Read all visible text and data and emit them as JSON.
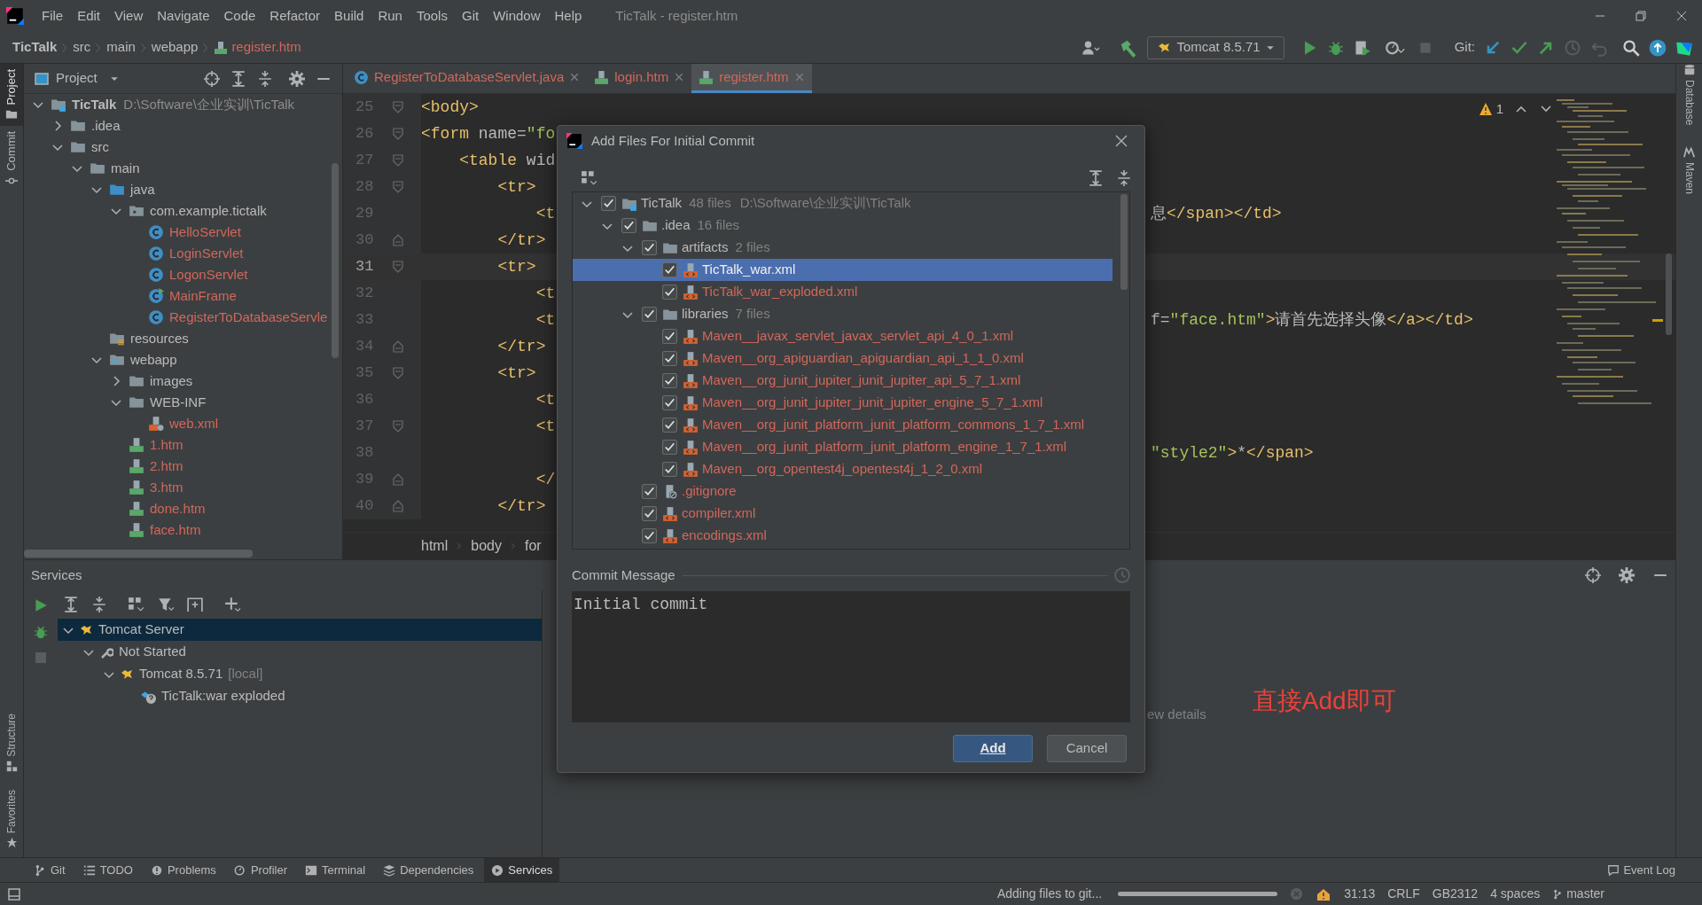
{
  "menu": {
    "items": [
      "File",
      "Edit",
      "View",
      "Navigate",
      "Code",
      "Refactor",
      "Build",
      "Run",
      "Tools",
      "Git",
      "Window",
      "Help"
    ],
    "title": "TicTalk - register.htm"
  },
  "breadcrumbs": [
    {
      "label": "TicTalk",
      "kind": "project"
    },
    {
      "label": "src",
      "kind": "folder"
    },
    {
      "label": "main",
      "kind": "folder"
    },
    {
      "label": "webapp",
      "kind": "folder"
    },
    {
      "label": "register.htm",
      "kind": "file"
    }
  ],
  "run_config": "Tomcat 8.5.71",
  "git_label": "Git:",
  "left_tool_tabs": [
    {
      "label": "Project",
      "selected": true
    },
    {
      "label": "Commit",
      "selected": false
    }
  ],
  "left_tool_tabs_bottom": [
    {
      "label": "Structure"
    },
    {
      "label": "Favorites"
    }
  ],
  "right_tool_tabs": [
    {
      "label": "Database"
    },
    {
      "label": "Maven"
    }
  ],
  "project": {
    "title": "Project",
    "tree": [
      {
        "label": "TicTalk",
        "hint": "D:\\Software\\企业实训\\TicTalk",
        "kind": "module",
        "expanded": true,
        "unversioned": false,
        "children": [
          {
            "label": ".idea",
            "kind": "folder",
            "expanded": false,
            "unversioned": false
          },
          {
            "label": "src",
            "kind": "folder",
            "expanded": true,
            "unversioned": false,
            "children": [
              {
                "label": "main",
                "kind": "folder",
                "expanded": true,
                "unversioned": false,
                "children": [
                  {
                    "label": "java",
                    "kind": "source",
                    "expanded": true,
                    "unversioned": false,
                    "children": [
                      {
                        "label": "com.example.tictalk",
                        "kind": "package",
                        "expanded": true,
                        "unversioned": false,
                        "children": [
                          {
                            "label": "HelloServlet",
                            "kind": "class",
                            "unversioned": true
                          },
                          {
                            "label": "LoginServlet",
                            "kind": "class",
                            "unversioned": true
                          },
                          {
                            "label": "LogonServlet",
                            "kind": "class",
                            "unversioned": true
                          },
                          {
                            "label": "MainFrame",
                            "kind": "main-class",
                            "unversioned": true
                          },
                          {
                            "label": "RegisterToDatabaseServle",
                            "kind": "class",
                            "unversioned": true
                          }
                        ]
                      }
                    ]
                  },
                  {
                    "label": "resources",
                    "kind": "resources",
                    "unversioned": false
                  },
                  {
                    "label": "webapp",
                    "kind": "webapp",
                    "expanded": true,
                    "unversioned": false,
                    "children": [
                      {
                        "label": "images",
                        "kind": "folder",
                        "expanded": false,
                        "unversioned": false
                      },
                      {
                        "label": "WEB-INF",
                        "kind": "folder",
                        "expanded": true,
                        "unversioned": false,
                        "children": [
                          {
                            "label": "web.xml",
                            "kind": "webxml",
                            "unversioned": true
                          }
                        ]
                      },
                      {
                        "label": "1.htm",
                        "kind": "html",
                        "unversioned": true
                      },
                      {
                        "label": "2.htm",
                        "kind": "html",
                        "unversioned": true
                      },
                      {
                        "label": "3.htm",
                        "kind": "html",
                        "unversioned": true
                      },
                      {
                        "label": "done.htm",
                        "kind": "html",
                        "unversioned": true
                      },
                      {
                        "label": "face.htm",
                        "kind": "html",
                        "unversioned": true
                      }
                    ]
                  }
                ]
              }
            ]
          }
        ]
      }
    ]
  },
  "editor": {
    "tabs": [
      {
        "label": "RegisterToDatabaseServlet.java",
        "kind": "class",
        "selected": false
      },
      {
        "label": "login.htm",
        "kind": "html",
        "selected": false
      },
      {
        "label": "register.htm",
        "kind": "html",
        "selected": true
      }
    ],
    "warnings": "1",
    "lines": [
      {
        "number": "25",
        "code": "<body>",
        "kind": "fold_start",
        "current": false
      },
      {
        "number": "26",
        "code": "<form name=\"fo",
        "kind": "fold_start",
        "current": false
      },
      {
        "number": "27",
        "code": "    <table wid",
        "kind": "fold_start",
        "current": false
      },
      {
        "number": "28",
        "code": "        <tr>",
        "kind": "fold_start",
        "current": false
      },
      {
        "number": "29",
        "code": "            <t",
        "right": "息</span></td>",
        "kind": "plain",
        "current": false
      },
      {
        "number": "30",
        "code": "        </tr>",
        "kind": "fold_end",
        "current": false
      },
      {
        "number": "31",
        "code": "        <tr>",
        "kind": "fold_start",
        "current": true
      },
      {
        "number": "32",
        "code": "            <t",
        "kind": "plain",
        "current": false
      },
      {
        "number": "33",
        "code": "            <t",
        "right": "f=\"face.htm\">请首先选择头像</a></td>",
        "kind": "plain",
        "current": false
      },
      {
        "number": "34",
        "code": "        </tr>",
        "kind": "fold_end",
        "current": false
      },
      {
        "number": "35",
        "code": "        <tr>",
        "kind": "fold_start",
        "current": false
      },
      {
        "number": "36",
        "code": "            <t",
        "kind": "plain",
        "current": false
      },
      {
        "number": "37",
        "code": "            <t",
        "kind": "fold_start",
        "current": false
      },
      {
        "number": "38",
        "right": "\"style2\">*</span>",
        "kind": "plain",
        "current": false
      },
      {
        "number": "39",
        "code": "            </",
        "kind": "fold_end",
        "current": false
      },
      {
        "number": "40",
        "code": "        </tr>",
        "kind": "fold_end",
        "current": false
      }
    ],
    "breadcrumbs": [
      "html",
      "body",
      "for"
    ]
  },
  "dialog": {
    "title": "Add Files For Initial Commit",
    "tree": [
      {
        "label": "TicTalk",
        "count": "48 files",
        "path": "D:\\Software\\企业实训\\TicTalk",
        "kind": "module",
        "checked": true,
        "expanded": true,
        "selected": false,
        "unversioned": false,
        "children": [
          {
            "label": ".idea",
            "count": "16 files",
            "kind": "folder",
            "checked": true,
            "expanded": true,
            "selected": false,
            "unversioned": false,
            "children": [
              {
                "label": "artifacts",
                "count": "2 files",
                "kind": "folder",
                "checked": true,
                "expanded": true,
                "selected": false,
                "unversioned": false,
                "children": [
                  {
                    "label": "TicTalk_war.xml",
                    "kind": "xml",
                    "checked": true,
                    "selected": true,
                    "unversioned": true
                  },
                  {
                    "label": "TicTalk_war_exploded.xml",
                    "kind": "xml",
                    "checked": true,
                    "selected": false,
                    "unversioned": true
                  }
                ]
              },
              {
                "label": "libraries",
                "count": "7 files",
                "kind": "folder",
                "checked": true,
                "expanded": true,
                "selected": false,
                "unversioned": false,
                "children": [
                  {
                    "label": "Maven__javax_servlet_javax_servlet_api_4_0_1.xml",
                    "kind": "xml",
                    "checked": true,
                    "selected": false,
                    "unversioned": true
                  },
                  {
                    "label": "Maven__org_apiguardian_apiguardian_api_1_1_0.xml",
                    "kind": "xml",
                    "checked": true,
                    "selected": false,
                    "unversioned": true
                  },
                  {
                    "label": "Maven__org_junit_jupiter_junit_jupiter_api_5_7_1.xml",
                    "kind": "xml",
                    "checked": true,
                    "selected": false,
                    "unversioned": true
                  },
                  {
                    "label": "Maven__org_junit_jupiter_junit_jupiter_engine_5_7_1.xml",
                    "kind": "xml",
                    "checked": true,
                    "selected": false,
                    "unversioned": true
                  },
                  {
                    "label": "Maven__org_junit_platform_junit_platform_commons_1_7_1.xml",
                    "kind": "xml",
                    "checked": true,
                    "selected": false,
                    "unversioned": true
                  },
                  {
                    "label": "Maven__org_junit_platform_junit_platform_engine_1_7_1.xml",
                    "kind": "xml",
                    "checked": true,
                    "selected": false,
                    "unversioned": true
                  },
                  {
                    "label": "Maven__org_opentest4j_opentest4j_1_2_0.xml",
                    "kind": "xml",
                    "checked": true,
                    "selected": false,
                    "unversioned": true
                  }
                ]
              },
              {
                "label": ".gitignore",
                "kind": "ignore",
                "checked": true,
                "selected": false,
                "unversioned": true
              },
              {
                "label": "compiler.xml",
                "kind": "xml",
                "checked": true,
                "selected": false,
                "unversioned": true
              },
              {
                "label": "encodings.xml",
                "kind": "xml",
                "checked": true,
                "selected": false,
                "unversioned": true
              }
            ]
          }
        ]
      }
    ],
    "message_label": "Commit Message",
    "message": "Initial commit",
    "buttons": [
      {
        "label": "Add",
        "default": true
      },
      {
        "label": "Cancel",
        "default": false
      }
    ]
  },
  "services": {
    "title": "Services",
    "tree": [
      {
        "label": "Tomcat Server",
        "kind": "tomcat",
        "expanded": true,
        "selected": true,
        "children": [
          {
            "label": "Not Started",
            "kind": "wrench",
            "expanded": true,
            "selected": false,
            "children": [
              {
                "label": "Tomcat 8.5.71",
                "hint": "[local]",
                "kind": "tomcat",
                "expanded": true,
                "selected": false,
                "children": [
                  {
                    "label": "TicTalk:war exploded",
                    "kind": "artifact",
                    "selected": false
                  }
                ]
              }
            ]
          }
        ]
      }
    ],
    "detail_text": "ew details"
  },
  "annotation": "直接Add即可",
  "tool_tabs": [
    {
      "label": "Git",
      "kind": "git",
      "selected": false
    },
    {
      "label": "TODO",
      "kind": "todo",
      "selected": false
    },
    {
      "label": "Problems",
      "kind": "problems",
      "selected": false
    },
    {
      "label": "Profiler",
      "kind": "profiler",
      "selected": false
    },
    {
      "label": "Terminal",
      "kind": "terminal",
      "selected": false
    },
    {
      "label": "Dependencies",
      "kind": "dependencies",
      "selected": false
    },
    {
      "label": "Services",
      "kind": "services",
      "selected": true
    }
  ],
  "event_log": "Event Log",
  "status": {
    "message": "Adding files to git...",
    "level": 1,
    "items": [
      "31:13",
      "CRLF",
      "GB2312",
      "4 spaces",
      "master"
    ]
  }
}
